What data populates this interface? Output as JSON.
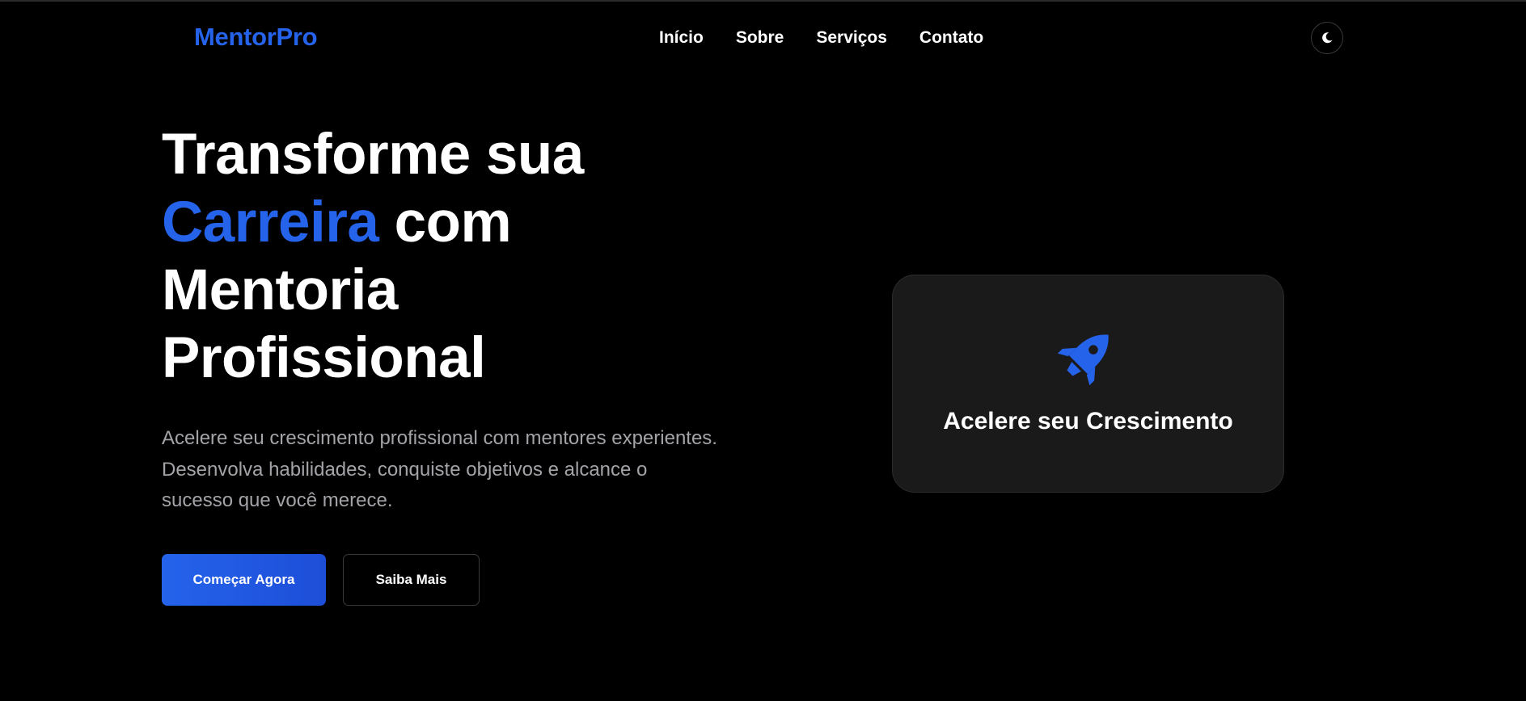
{
  "brand": {
    "name": "MentorPro",
    "accent_color": "#2563eb"
  },
  "nav": {
    "items": [
      {
        "label": "Início"
      },
      {
        "label": "Sobre"
      },
      {
        "label": "Serviços"
      },
      {
        "label": "Contato"
      }
    ],
    "theme_toggle_icon": "moon-icon"
  },
  "hero": {
    "title_line1": "Transforme sua",
    "title_accent": "Carreira",
    "title_after_accent": " com",
    "title_line3": "Mentoria",
    "title_line4": "Profissional",
    "description": "Acelere seu crescimento profissional com mentores experientes. Desenvolva habilidades, conquiste objetivos e alcance o sucesso que você merece.",
    "primary_button": "Começar Agora",
    "secondary_button": "Saiba Mais"
  },
  "card": {
    "icon": "rocket-icon",
    "title": "Acelere seu Crescimento"
  }
}
